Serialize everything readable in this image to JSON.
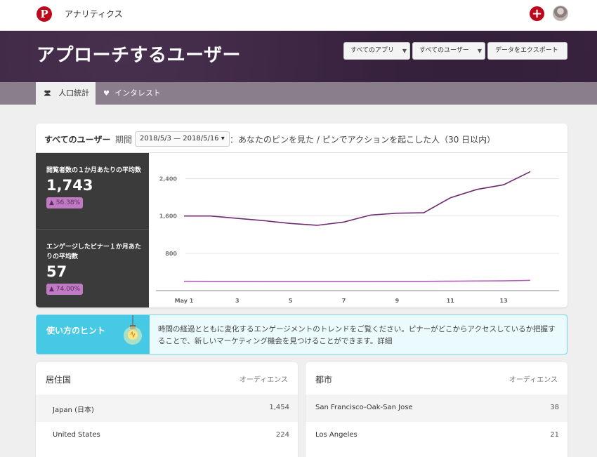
{
  "topbar": {
    "logo": "P",
    "title": "アナリティクス",
    "plus": "+"
  },
  "hero": {
    "title": "アプローチするユーザー",
    "apps_label": "すべてのアプリ",
    "users_label": "すべてのユーザー",
    "export_label": "データをエクスポート"
  },
  "tabs": [
    {
      "label": "人口統計",
      "icon": "users-icon"
    },
    {
      "label": "インタレスト",
      "icon": "heart-icon"
    }
  ],
  "overview": {
    "users_label": "すべてのユーザー",
    "period_label": "期間",
    "date_range": "2018/5/3 — 2018/5/16 ▾",
    "description": "：あなたのピンを見た / ピンでアクションを起こした人（30 日以内）"
  },
  "stats": [
    {
      "label": "閲覧者数の１か月あたりの平均数",
      "value": "1,743",
      "change": "56.38%"
    },
    {
      "label": "エンゲージしたピナー１か月あたりの平均数",
      "value": "57",
      "change": "74.00%"
    }
  ],
  "chart_data": {
    "type": "line",
    "x": [
      1,
      2,
      3,
      4,
      5,
      6,
      7,
      8,
      9,
      10,
      11,
      12,
      13,
      14
    ],
    "x_tick_labels": [
      "May 1",
      "3",
      "5",
      "7",
      "9",
      "11",
      "13"
    ],
    "x_tick_positions": [
      1,
      3,
      5,
      7,
      9,
      11,
      13
    ],
    "y_ticks": [
      800,
      1600,
      2400
    ],
    "ylim": [
      0,
      2950
    ],
    "series": [
      {
        "values": [
          1600,
          1600,
          1550,
          1500,
          1440,
          1400,
          1470,
          1620,
          1660,
          1670,
          1990,
          2170,
          2270,
          2550
        ],
        "color": "#6e2a6f"
      },
      {
        "values": [
          200,
          198,
          198,
          197,
          196,
          196,
          196,
          197,
          198,
          199,
          203,
          207,
          210,
          220
        ],
        "color": "#b55bbb"
      }
    ],
    "grid": true
  },
  "hint": {
    "title": "使い方のヒント",
    "text": "時間の経過とともに変化するエンゲージメントのトレンドをご覧ください。ピナーがどこからアクセスしているか把握することで、新しいマーケティング機会を見つけることができます。",
    "link": "詳細"
  },
  "countries": {
    "title": "居住国",
    "column": "オーディエンス",
    "rows": [
      {
        "name": "Japan (日本)",
        "value": "1,454"
      },
      {
        "name": "United States",
        "value": "224"
      }
    ]
  },
  "cities": {
    "title": "都市",
    "column": "オーディエンス",
    "rows": [
      {
        "name": "San Francisco-Oak-San Jose",
        "value": "38"
      },
      {
        "name": "Los Angeles",
        "value": "21"
      }
    ]
  }
}
